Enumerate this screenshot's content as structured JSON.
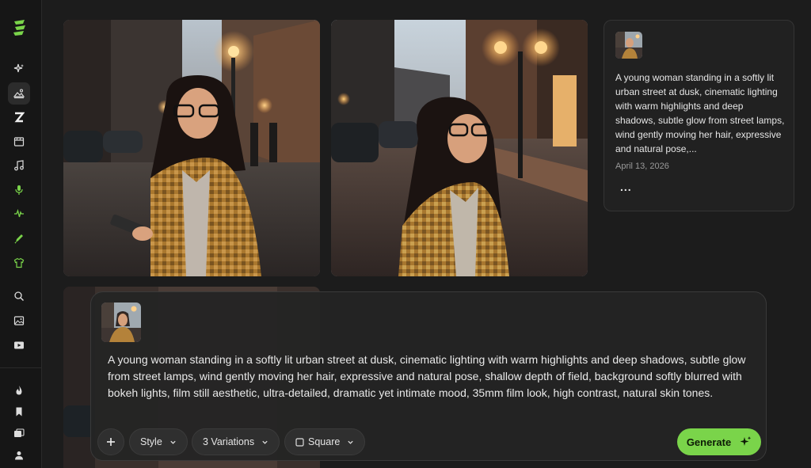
{
  "sidebar": {
    "items": [
      {
        "icon": "sparkle-icon"
      },
      {
        "icon": "image-generate-icon",
        "active": true
      },
      {
        "icon": "z-logo-icon"
      },
      {
        "icon": "video-clapper-icon"
      },
      {
        "icon": "music-note-icon"
      },
      {
        "icon": "microphone-icon"
      },
      {
        "icon": "audio-wave-icon"
      },
      {
        "icon": "brush-icon"
      },
      {
        "icon": "tshirt-icon"
      },
      {
        "icon": "search-icon"
      },
      {
        "icon": "gallery-icon"
      },
      {
        "icon": "video-play-icon"
      },
      {
        "icon": "flame-icon"
      },
      {
        "icon": "bookmark-icon"
      },
      {
        "icon": "folders-icon"
      },
      {
        "icon": "user-icon"
      }
    ],
    "accent": "#7ad44a"
  },
  "info_card": {
    "prompt": "A young woman standing in a softly lit urban street at dusk, cinematic lighting with warm highlights and deep shadows, subtle glow from street lamps, wind gently moving her hair, expressive and natural pose,...",
    "date": "April 13, 2026",
    "more_label": "..."
  },
  "composer": {
    "prompt": "A young woman standing in a softly lit urban street at dusk, cinematic lighting with warm highlights and deep shadows, subtle glow from street lamps, wind gently moving her hair, expressive and natural pose, shallow depth of field, background softly blurred with bokeh lights, film still aesthetic, ultra-detailed, dramatic yet intimate mood, 35mm film look, high contrast, natural skin tones.",
    "style_label": "Style",
    "variations_label": "3 Variations",
    "aspect_label": "Square",
    "generate_label": "Generate"
  },
  "colors": {
    "background": "#1c1c1c",
    "sidebar": "#161616",
    "card": "#212121",
    "generate": "#7ad44a"
  }
}
